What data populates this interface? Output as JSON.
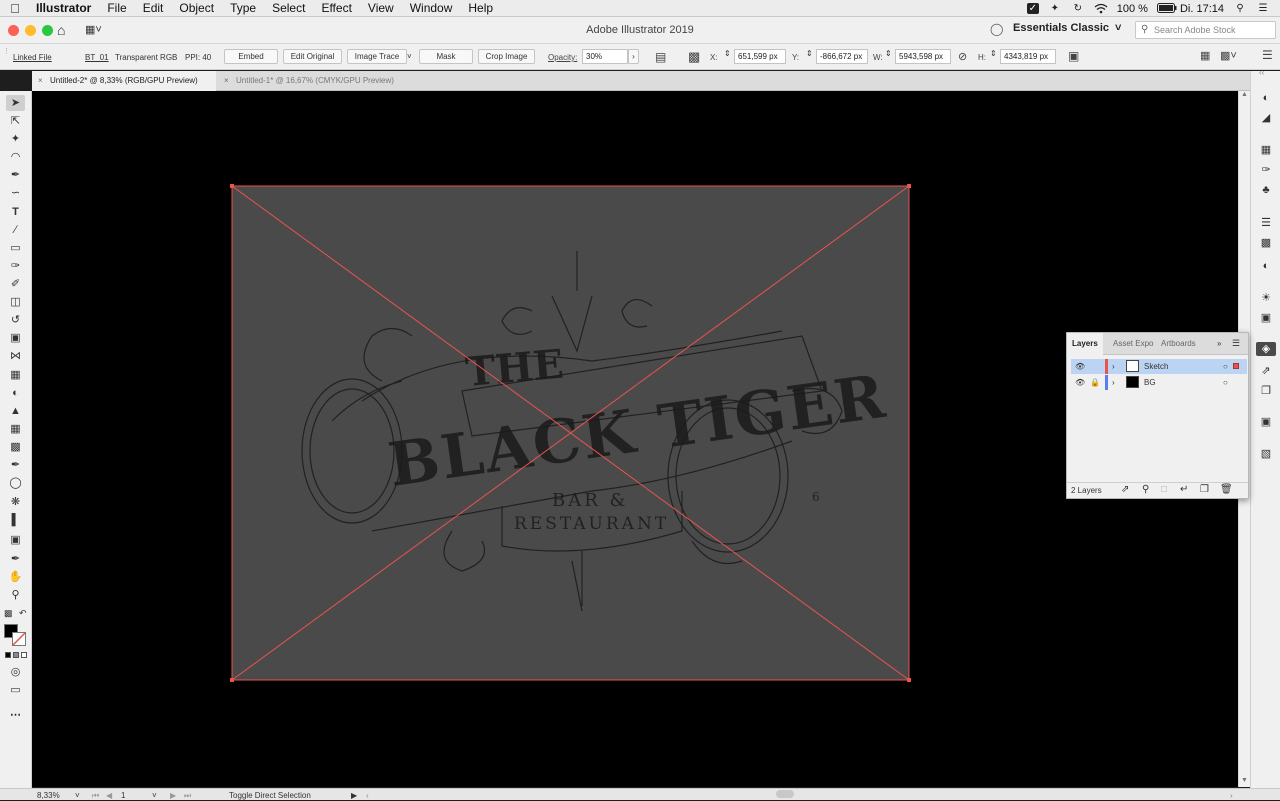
{
  "menubar": {
    "apple": "",
    "items": [
      "Illustrator",
      "File",
      "Edit",
      "Object",
      "Type",
      "Select",
      "Effect",
      "View",
      "Window",
      "Help"
    ],
    "battery": "100 %",
    "clock": "Di. 17:14"
  },
  "appbar": {
    "title": "Adobe Illustrator 2019",
    "workspace": "Essentials Classic",
    "stock_placeholder": "Search Adobe Stock"
  },
  "controlbar": {
    "linked_file": "Linked File",
    "file_name": "BT_01",
    "color_info": "Transparent RGB",
    "ppi": "PPI: 40",
    "embed": "Embed",
    "edit_original": "Edit Original",
    "image_trace": "Image Trace",
    "mask": "Mask",
    "crop_image": "Crop Image",
    "opacity_label": "Opacity:",
    "opacity_value": "30%",
    "x_label": "X:",
    "x_value": "651,599 px",
    "y_label": "Y:",
    "y_value": "-866,672 px",
    "w_label": "W:",
    "w_value": "5943,598 px",
    "h_label": "H:",
    "h_value": "4343,819 px"
  },
  "tabs": [
    {
      "label": "Untitled-2* @ 8,33% (RGB/GPU Preview)",
      "active": true
    },
    {
      "label": "Untitled-1* @ 16,67% (CMYK/GPU Preview)",
      "active": false
    }
  ],
  "artwork": {
    "line1": "THE",
    "line2": "BLACK TIGER",
    "line3": "BAR &",
    "line4": "RESTAURANT",
    "mark": "6"
  },
  "layers_panel": {
    "tabs": [
      "Layers",
      "Asset Expo",
      "Artboards"
    ],
    "layers": [
      {
        "name": "Sketch",
        "color": "#e8544c",
        "locked": false,
        "selected": true
      },
      {
        "name": "BG",
        "color": "#5c7cf0",
        "locked": true,
        "selected": false
      }
    ],
    "count": "2 Layers"
  },
  "statusbar": {
    "zoom": "8,33%",
    "artboard": "1",
    "status": "Toggle Direct Selection"
  },
  "colors": {
    "selection": "#e8544c",
    "artboard_gray": "#4a4a4a",
    "canvas": "#000000"
  }
}
